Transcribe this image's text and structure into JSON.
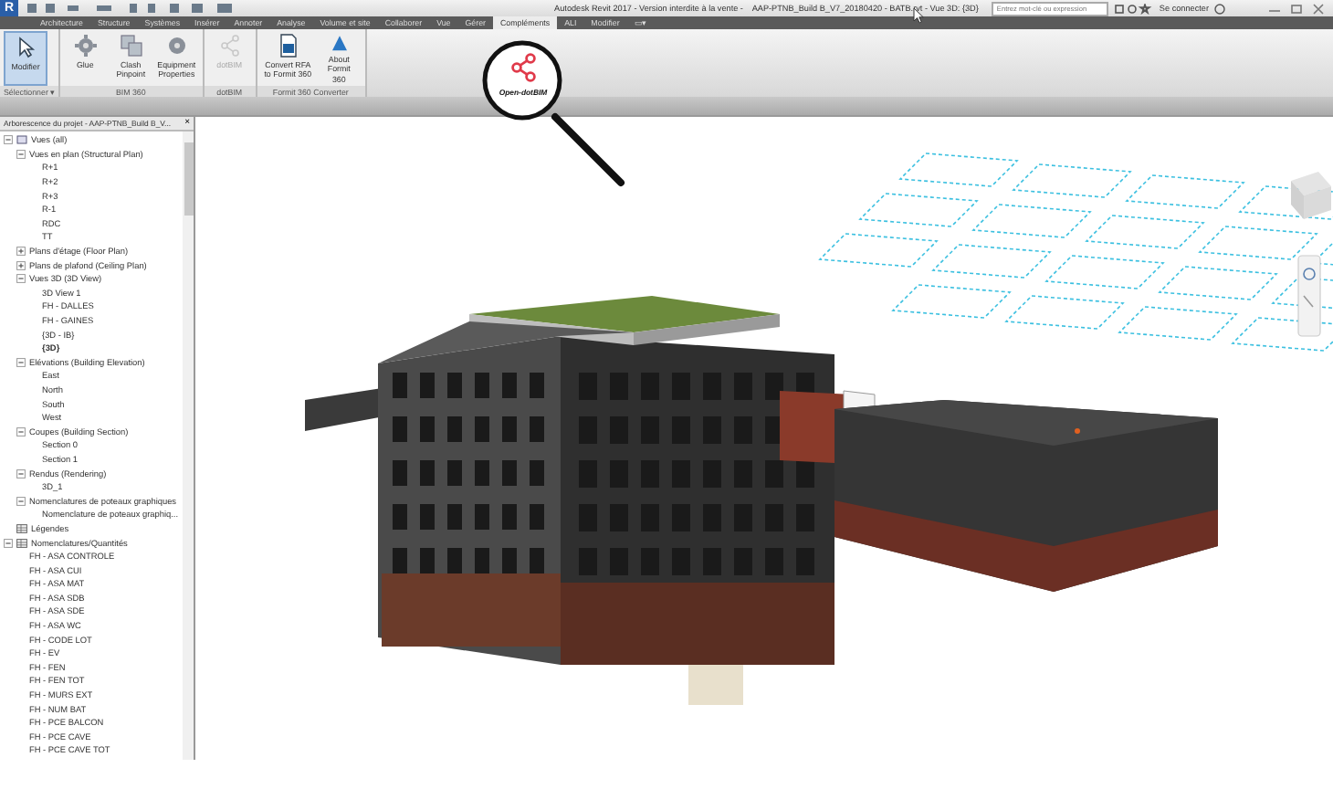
{
  "window": {
    "logo": "R",
    "title": "Autodesk Revit 2017 - Version interdite à la vente -    AAP-PTNB_Build B_V7_20180420 - BATB.rvt - Vue 3D: {3D}",
    "search": {
      "placeholder": "Entrez mot-clé ou expression"
    },
    "sign_in": "Se connecter"
  },
  "tabs": [
    {
      "label": "Architecture",
      "selected": false
    },
    {
      "label": "Structure",
      "selected": false
    },
    {
      "label": "Systèmes",
      "selected": false
    },
    {
      "label": "Insérer",
      "selected": false
    },
    {
      "label": "Annoter",
      "selected": false
    },
    {
      "label": "Analyse",
      "selected": false
    },
    {
      "label": "Volume et site",
      "selected": false
    },
    {
      "label": "Collaborer",
      "selected": false
    },
    {
      "label": "Vue",
      "selected": false
    },
    {
      "label": "Gérer",
      "selected": false
    },
    {
      "label": "Compléments",
      "selected": true
    },
    {
      "label": "ALI",
      "selected": false
    },
    {
      "label": "Modifier",
      "selected": false
    },
    {
      "label": "▭▾",
      "selected": false
    }
  ],
  "ribbon": [
    {
      "label": "Sélectionner ▾",
      "buttons": [
        {
          "label": "Modifier",
          "kind": "cursor",
          "selected": true,
          "disabled": false
        }
      ]
    },
    {
      "label": "BIM 360",
      "buttons": [
        {
          "label": "Glue",
          "kind": "glue",
          "selected": false,
          "disabled": false
        },
        {
          "label": "Clash Pinpoint",
          "kind": "clash",
          "selected": false,
          "disabled": false
        },
        {
          "label": "Equipment Properties",
          "kind": "equip",
          "selected": false,
          "disabled": false
        }
      ]
    },
    {
      "label": "dotBIM",
      "buttons": [
        {
          "label": "dotBIM",
          "kind": "share",
          "selected": false,
          "disabled": true
        }
      ]
    },
    {
      "label": "Formit 360 Converter",
      "buttons": [
        {
          "label": "Convert RFA to Formit 360",
          "kind": "convert",
          "selected": false,
          "disabled": false
        },
        {
          "label": "About Formit 360",
          "kind": "about",
          "selected": false,
          "disabled": false
        }
      ]
    }
  ],
  "magnifier": {
    "label": "Open-dotBIM"
  },
  "browser": {
    "title": "Arborescence du projet - AAP-PTNB_Build B_V...",
    "close": "×",
    "tree": [
      {
        "label": "Vues (all)",
        "kind": "views",
        "expanded": true,
        "children": [
          {
            "label": "Vues en plan (Structural Plan)",
            "expanded": true,
            "children": [
              {
                "label": "R+1"
              },
              {
                "label": "R+2"
              },
              {
                "label": "R+3"
              },
              {
                "label": "R-1"
              },
              {
                "label": "RDC"
              },
              {
                "label": "TT"
              }
            ]
          },
          {
            "label": "Plans d'étage (Floor Plan)",
            "expanded": false
          },
          {
            "label": "Plans de plafond (Ceiling Plan)",
            "expanded": false
          },
          {
            "label": "Vues 3D (3D View)",
            "expanded": true,
            "children": [
              {
                "label": "3D View 1",
                "active": false
              },
              {
                "label": "FH - DALLES",
                "active": false
              },
              {
                "label": "FH - GAINES",
                "active": false
              },
              {
                "label": "{3D - IB}",
                "active": false
              },
              {
                "label": "{3D}",
                "active": true
              }
            ]
          },
          {
            "label": "Elévations (Building Elevation)",
            "expanded": true,
            "children": [
              {
                "label": "East"
              },
              {
                "label": "North"
              },
              {
                "label": "South"
              },
              {
                "label": "West"
              }
            ]
          },
          {
            "label": "Coupes (Building Section)",
            "expanded": true,
            "children": [
              {
                "label": "Section 0"
              },
              {
                "label": "Section 1"
              }
            ]
          },
          {
            "label": "Rendus (Rendering)",
            "expanded": true,
            "children": [
              {
                "label": "3D_1"
              }
            ]
          },
          {
            "label": "Nomenclatures de poteaux graphiques",
            "expanded": true,
            "children": [
              {
                "label": "Nomenclature de poteaux graphiq..."
              }
            ]
          }
        ]
      },
      {
        "label": "Légendes",
        "kind": "legend"
      },
      {
        "label": "Nomenclatures/Quantités",
        "kind": "schedule",
        "expanded": true,
        "children": [
          {
            "label": "FH - ASA CONTROLE"
          },
          {
            "label": "FH - ASA CUI"
          },
          {
            "label": "FH - ASA MAT"
          },
          {
            "label": "FH - ASA SDB"
          },
          {
            "label": "FH - ASA SDE"
          },
          {
            "label": "FH - ASA WC"
          },
          {
            "label": "FH - CODE LOT"
          },
          {
            "label": "FH - EV"
          },
          {
            "label": "FH - FEN"
          },
          {
            "label": "FH - FEN TOT"
          },
          {
            "label": "FH - MURS EXT"
          },
          {
            "label": "FH - NUM BAT"
          },
          {
            "label": "FH - PCE BALCON"
          },
          {
            "label": "FH - PCE CAVE"
          },
          {
            "label": "FH - PCE CAVE TOT"
          }
        ]
      }
    ]
  }
}
